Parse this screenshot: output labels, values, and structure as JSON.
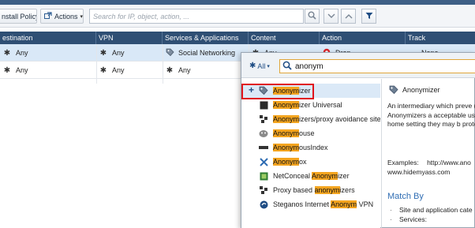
{
  "toolbar": {
    "install_policy": "nstall Policy",
    "actions": "Actions",
    "search_placeholder": "Search for IP, object, action, ..."
  },
  "table": {
    "headers": [
      "estination",
      "VPN",
      "Services & Applications",
      "Content",
      "Action",
      "Track"
    ],
    "rows": [
      {
        "destination": "Any",
        "vpn": "Any",
        "services": "Social Networking",
        "content": "Any",
        "action": "Drop",
        "track": "None"
      },
      {
        "destination": "Any",
        "vpn": "Any",
        "services": "Any"
      }
    ]
  },
  "popup": {
    "filter_label": "All",
    "search_value": "anonym",
    "items": [
      {
        "pre": "",
        "match": "Anonym",
        "post": "izer",
        "icon": "tag-icon"
      },
      {
        "pre": "",
        "match": "Anonym",
        "post": "izer Universal",
        "icon": "app-icon"
      },
      {
        "pre": "",
        "match": "Anonym",
        "post": "izers/proxy avoidance sites",
        "icon": "category-icon"
      },
      {
        "pre": "",
        "match": "Anonym",
        "post": "ouse",
        "icon": "mouse-logo-icon"
      },
      {
        "pre": "",
        "match": "Anonym",
        "post": "ousIndex",
        "icon": "bar-icon"
      },
      {
        "pre": "",
        "match": "Anonym",
        "post": "ox",
        "icon": "x-logo-icon"
      },
      {
        "pre": "NetConceal ",
        "match": "Anonym",
        "post": "izer",
        "icon": "netconceal-icon"
      },
      {
        "pre": "Proxy based ",
        "match": "anonym",
        "post": "izers",
        "icon": "category-icon"
      },
      {
        "pre": "Steganos Internet ",
        "match": "Anonym",
        "post": " VPN",
        "icon": "steganos-icon"
      }
    ],
    "detail": {
      "title": "Anonymizer",
      "description": "An intermediary which preve (IP) address.  Anonymizers a acceptable use policies to po the home setting they may b protect privacy.",
      "examples_label": "Examples:",
      "examples_value": "http://www.ano",
      "examples_value2": "www.hidemyass.com",
      "match_by": "Match By",
      "bullets": [
        "Site and application cate",
        "Services:"
      ]
    }
  },
  "colors": {
    "header_bg": "#2f4f74",
    "highlight": "#f4a520",
    "selection": "#d9e8f7",
    "drop_red": "#d9262b",
    "red_box": "#e0141c"
  }
}
